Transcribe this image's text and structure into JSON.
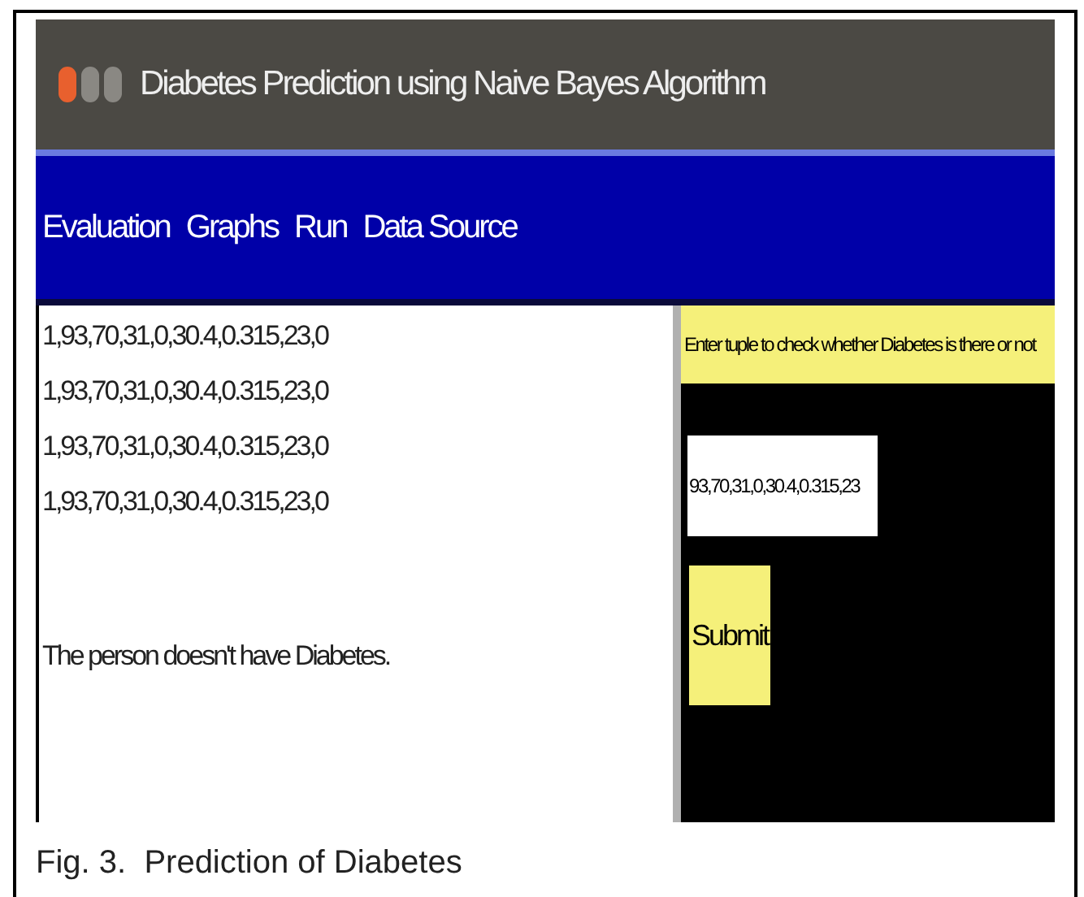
{
  "window": {
    "title": "Diabetes Prediction using Naive Bayes Algorithm"
  },
  "menu": [
    "Evaluation",
    "Graphs",
    "Run",
    "Data Source"
  ],
  "output": {
    "lines": [
      "1,93,70,31,0,30.4,0.315,23,0",
      "1,93,70,31,0,30.4,0.315,23,0",
      "1,93,70,31,0,30.4,0.315,23,0",
      "1,93,70,31,0,30.4,0.315,23,0"
    ],
    "result": "The person doesn't have Diabetes."
  },
  "input_panel": {
    "label": "Enter tuple to check whether Diabetes is there or not",
    "value": "93,70,31,0,30.4,0.315,23",
    "button": "Submit"
  },
  "caption": "Fig. 3.  Prediction of Diabetes"
}
